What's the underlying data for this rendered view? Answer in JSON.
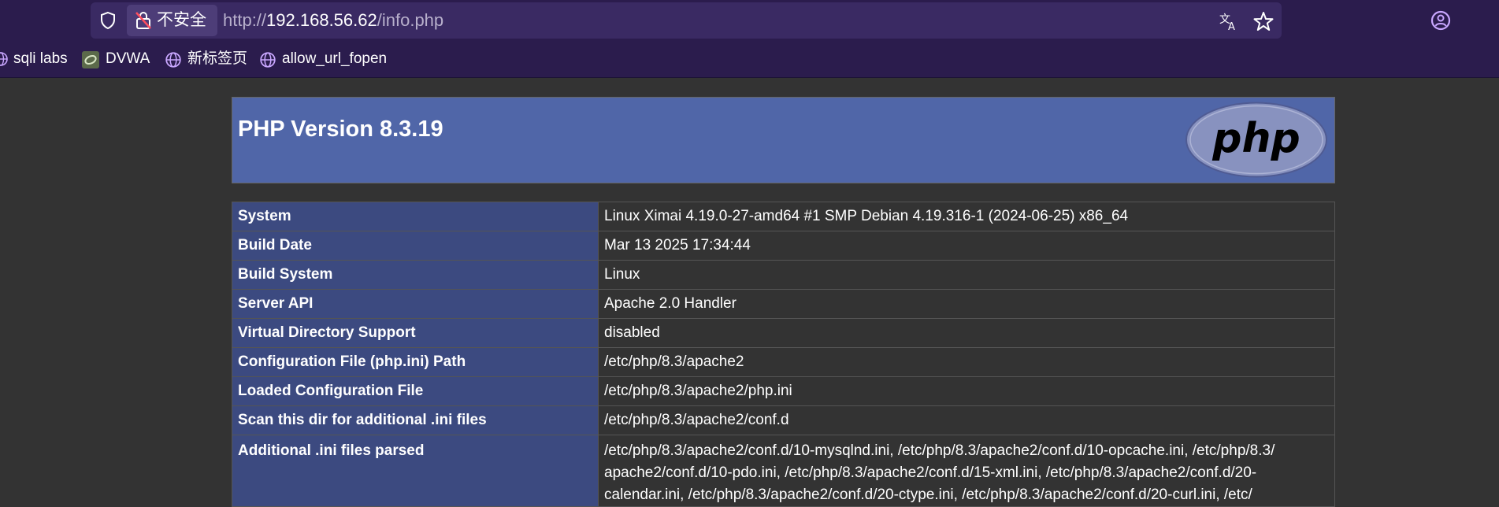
{
  "browser": {
    "insecure_label": "不安全",
    "url_prefix": "http://",
    "url_host": "192.168.56.62",
    "url_path": "/info.php"
  },
  "bookmarks": [
    {
      "label": "sqli labs",
      "icon": "globe-icon"
    },
    {
      "label": "DVWA",
      "icon": "dvwa-favicon"
    },
    {
      "label": "新标签页",
      "icon": "globe-icon"
    },
    {
      "label": "allow_url_fopen",
      "icon": "globe-icon"
    }
  ],
  "php": {
    "title": "PHP Version 8.3.19",
    "logo_text": "php"
  },
  "info_rows": [
    {
      "key": "System",
      "value": "Linux Ximai 4.19.0-27-amd64 #1 SMP Debian 4.19.316-1 (2024-06-25) x86_64"
    },
    {
      "key": "Build Date",
      "value": "Mar 13 2025 17:34:44"
    },
    {
      "key": "Build System",
      "value": "Linux"
    },
    {
      "key": "Server API",
      "value": "Apache 2.0 Handler"
    },
    {
      "key": "Virtual Directory Support",
      "value": "disabled"
    },
    {
      "key": "Configuration File (php.ini) Path",
      "value": "/etc/php/8.3/apache2"
    },
    {
      "key": "Loaded Configuration File",
      "value": "/etc/php/8.3/apache2/php.ini"
    },
    {
      "key": "Scan this dir for additional .ini files",
      "value": "/etc/php/8.3/apache2/conf.d"
    },
    {
      "key": "Additional .ini files parsed",
      "value_lines": [
        "/etc/php/8.3/apache2/conf.d/10-mysqlnd.ini, /etc/php/8.3/apache2/conf.d/10-opcache.ini, /etc/php/8.3/",
        "apache2/conf.d/10-pdo.ini, /etc/php/8.3/apache2/conf.d/15-xml.ini, /etc/php/8.3/apache2/conf.d/20-",
        "calendar.ini, /etc/php/8.3/apache2/conf.d/20-ctype.ini, /etc/php/8.3/apache2/conf.d/20-curl.ini, /etc/"
      ]
    }
  ],
  "colors": {
    "browser_bg": "#2b1c4d",
    "urlbar_bg": "#3a2a63",
    "page_bg": "#333333",
    "header_bg": "#5066a8",
    "key_cell_bg": "#3c4a80",
    "icon_accent": "#c9a7ff"
  }
}
